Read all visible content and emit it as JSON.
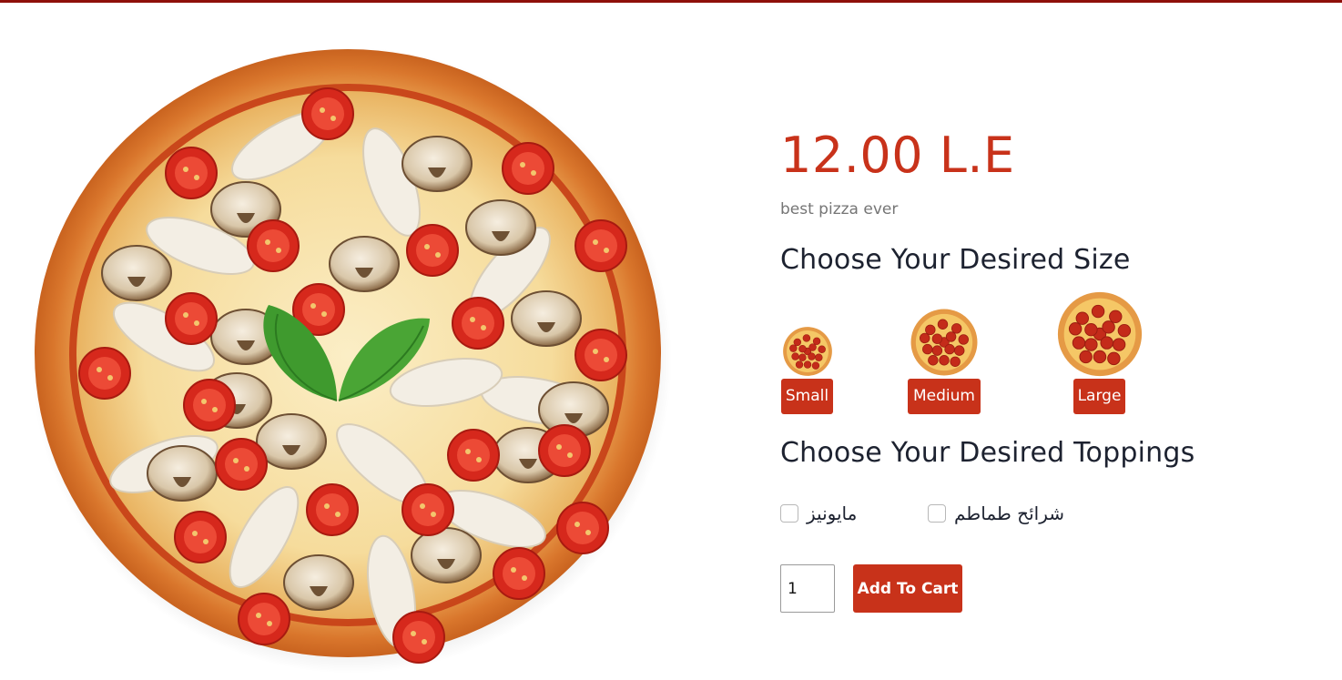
{
  "colors": {
    "accent": "#c8321a",
    "top_bar": "#8e0f0a",
    "heading": "#1d2230",
    "muted": "#757575"
  },
  "product": {
    "image_icon": "pizza-photo",
    "price": "12.00 L.E",
    "description": "best pizza ever"
  },
  "sizes": {
    "heading": "Choose Your Desired Size",
    "options": [
      {
        "label": "Small",
        "icon": "pepperoni-pizza-icon"
      },
      {
        "label": "Medium",
        "icon": "pepperoni-pizza-icon"
      },
      {
        "label": "Large",
        "icon": "pepperoni-pizza-icon"
      }
    ]
  },
  "toppings": {
    "heading": "Choose Your Desired Toppings",
    "options": [
      {
        "label": "مايونيز",
        "checked": false
      },
      {
        "label": "شرائح طماطم",
        "checked": false
      }
    ]
  },
  "cart": {
    "quantity": "1",
    "add_label": "Add To Cart"
  }
}
